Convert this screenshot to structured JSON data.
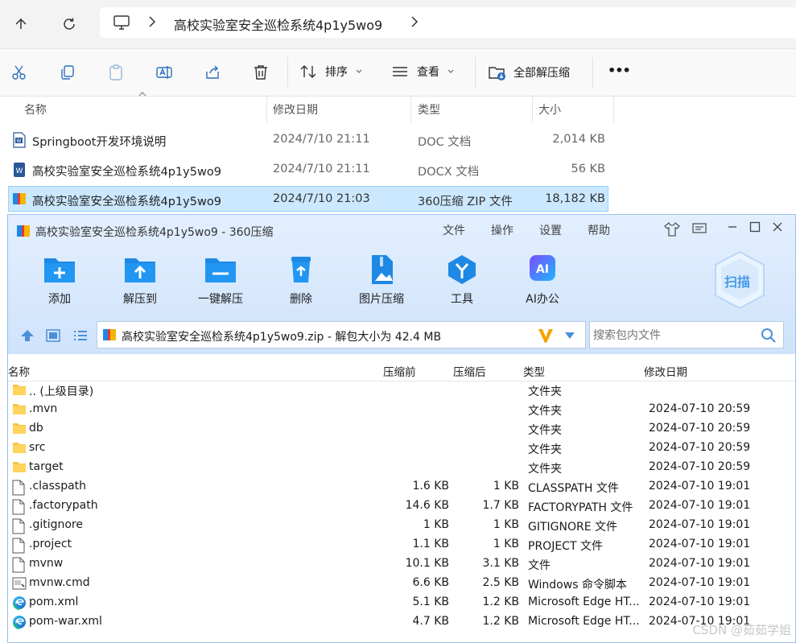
{
  "explorer": {
    "breadcrumb_current": "高校实验室安全巡检系统4p1y5wo9",
    "toolbar": {
      "sort_label": "排序",
      "view_label": "查看",
      "extract_all_label": "全部解压缩",
      "more_label": "•••"
    },
    "columns": {
      "name": "名称",
      "modified": "修改日期",
      "type": "类型",
      "size": "大小"
    },
    "files": [
      {
        "name": "Springboot开发环境说明",
        "modified": "2024/7/10 21:11",
        "type": "DOC 文档",
        "size": "2,014 KB"
      },
      {
        "name": "高校实验室安全巡检系统4p1y5wo9",
        "modified": "2024/7/10 21:11",
        "type": "DOCX 文档",
        "size": "56 KB"
      },
      {
        "name": "高校实验室安全巡检系统4p1y5wo9",
        "modified": "2024/7/10 21:03",
        "type": "360压缩 ZIP 文件",
        "size": "18,182 KB"
      }
    ]
  },
  "zip": {
    "title": "高校实验室安全巡检系统4p1y5wo9 - 360压缩",
    "menu": {
      "file": "文件",
      "ops": "操作",
      "settings": "设置",
      "help": "帮助"
    },
    "tools": {
      "add": "添加",
      "extract_to": "解压到",
      "one_click": "一键解压",
      "delete": "删除",
      "img_compress": "图片压缩",
      "tools": "工具",
      "ai": "AI办公"
    },
    "scan_label": "扫描",
    "ai_badge": "AI",
    "address": "高校实验室安全巡检系统4p1y5wo9.zip - 解包大小为 42.4 MB",
    "search_placeholder": "搜索包内文件",
    "columns": {
      "name": "名称",
      "before": "压缩前",
      "after": "压缩后",
      "type": "类型",
      "modified": "修改日期"
    },
    "entries": [
      {
        "name": ".. (上级目录)",
        "before": "",
        "after": "",
        "type": "文件夹",
        "modified": "",
        "icon": "folder-icon"
      },
      {
        "name": ".mvn",
        "before": "",
        "after": "",
        "type": "文件夹",
        "modified": "2024-07-10 20:59",
        "icon": "folder-icon"
      },
      {
        "name": "db",
        "before": "",
        "after": "",
        "type": "文件夹",
        "modified": "2024-07-10 20:59",
        "icon": "folder-icon"
      },
      {
        "name": "src",
        "before": "",
        "after": "",
        "type": "文件夹",
        "modified": "2024-07-10 20:59",
        "icon": "folder-icon"
      },
      {
        "name": "target",
        "before": "",
        "after": "",
        "type": "文件夹",
        "modified": "2024-07-10 20:59",
        "icon": "folder-icon"
      },
      {
        "name": ".classpath",
        "before": "1.6 KB",
        "after": "1 KB",
        "type": "CLASSPATH 文件",
        "modified": "2024-07-10 19:01",
        "icon": "file-icon"
      },
      {
        "name": ".factorypath",
        "before": "14.6 KB",
        "after": "1.7 KB",
        "type": "FACTORYPATH 文件",
        "modified": "2024-07-10 19:01",
        "icon": "file-icon"
      },
      {
        "name": ".gitignore",
        "before": "1 KB",
        "after": "1 KB",
        "type": "GITIGNORE 文件",
        "modified": "2024-07-10 19:01",
        "icon": "file-icon"
      },
      {
        "name": ".project",
        "before": "1.1 KB",
        "after": "1 KB",
        "type": "PROJECT 文件",
        "modified": "2024-07-10 19:01",
        "icon": "file-icon"
      },
      {
        "name": "mvnw",
        "before": "10.1 KB",
        "after": "3.1 KB",
        "type": "文件",
        "modified": "2024-07-10 19:01",
        "icon": "file-icon"
      },
      {
        "name": "mvnw.cmd",
        "before": "6.6 KB",
        "after": "2.5 KB",
        "type": "Windows 命令脚本",
        "modified": "2024-07-10 19:01",
        "icon": "cmd-file-icon"
      },
      {
        "name": "pom.xml",
        "before": "5.1 KB",
        "after": "1.2 KB",
        "type": "Microsoft Edge HT...",
        "modified": "2024-07-10 19:01",
        "icon": "edge-icon"
      },
      {
        "name": "pom-war.xml",
        "before": "4.7 KB",
        "after": "1.2 KB",
        "type": "Microsoft Edge HT...",
        "modified": "2024-07-10 19:01",
        "icon": "edge-icon"
      }
    ]
  },
  "watermark": "CSDN @茹茹学姐",
  "colors": {
    "selection": "#cce8ff",
    "zip_accent": "#1e88e5",
    "header_bg": "#dbe9fb"
  }
}
